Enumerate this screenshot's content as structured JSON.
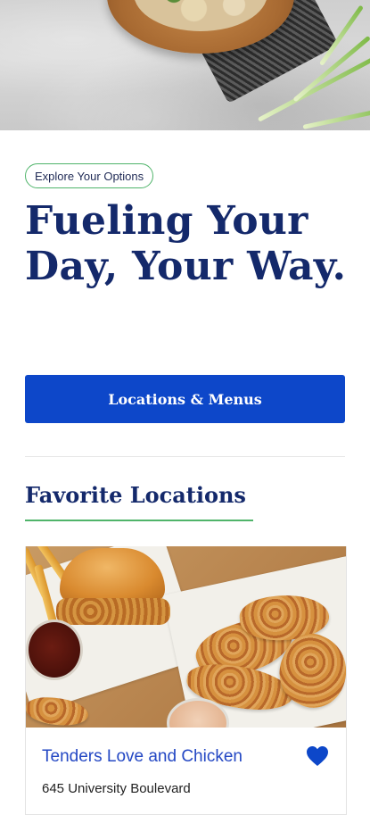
{
  "promo": {
    "tag_label": "Explore Your Options",
    "headline": "Fueling Your Day, Your Way.",
    "cta_label": "Locations & Menus"
  },
  "favorites": {
    "section_title": "Favorite Locations",
    "items": [
      {
        "name": "Tenders Love and Chicken",
        "address": "645 University Boulevard",
        "is_favorite": true
      }
    ]
  },
  "colors": {
    "primary": "#0d47c9",
    "heading": "#14296b",
    "accent_green": "#4fb46a",
    "link_blue": "#2448c4"
  },
  "icons": {
    "favorite": "heart-icon"
  }
}
